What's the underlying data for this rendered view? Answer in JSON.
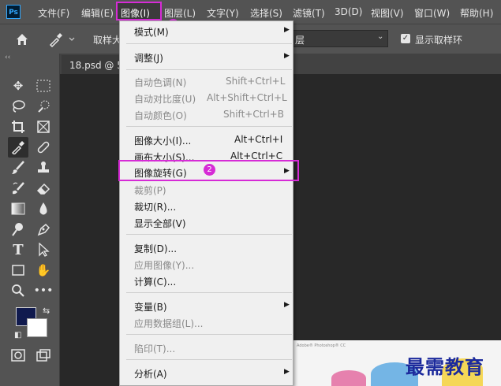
{
  "app": {
    "logo": "Ps"
  },
  "menubar": {
    "items": [
      "文件(F)",
      "编辑(E)",
      "图像(I)",
      "图层(L)",
      "文字(Y)",
      "选择(S)",
      "滤镜(T)",
      "3D(D)",
      "视图(V)",
      "窗口(W)",
      "帮助(H)"
    ],
    "active": "图像(I)"
  },
  "badges": {
    "first": "1",
    "second": "2"
  },
  "options_bar": {
    "sample_label": "取样大",
    "layer_value": "层",
    "ring_label": "显示取样环",
    "ring_checked": true
  },
  "toolbar": {
    "collapse": "‹‹"
  },
  "document": {
    "tab_label": "18.psd @ 5",
    "preview_text": "Adobe® Photoshop® CC"
  },
  "watermark": "最需教育",
  "image_menu": {
    "items": [
      {
        "label": "模式(M)",
        "submenu": true
      },
      {
        "label": "调整(J)",
        "submenu": true
      },
      {
        "label": "自动色调(N)",
        "shortcut": "Shift+Ctrl+L",
        "disabled": true
      },
      {
        "label": "自动对比度(U)",
        "shortcut": "Alt+Shift+Ctrl+L",
        "disabled": true
      },
      {
        "label": "自动颜色(O)",
        "shortcut": "Shift+Ctrl+B",
        "disabled": true
      },
      {
        "label": "图像大小(I)...",
        "shortcut": "Alt+Ctrl+I"
      },
      {
        "label": "画布大小(S)...",
        "shortcut": "Alt+Ctrl+C"
      },
      {
        "label": "图像旋转(G)",
        "submenu": true,
        "highlighted": true
      },
      {
        "label": "裁剪(P)",
        "disabled": true
      },
      {
        "label": "裁切(R)..."
      },
      {
        "label": "显示全部(V)"
      },
      {
        "label": "复制(D)..."
      },
      {
        "label": "应用图像(Y)...",
        "disabled": true
      },
      {
        "label": "计算(C)..."
      },
      {
        "label": "变量(B)",
        "submenu": true
      },
      {
        "label": "应用数据组(L)...",
        "disabled": true
      },
      {
        "label": "陷印(T)...",
        "disabled": true
      },
      {
        "label": "分析(A)",
        "submenu": true
      }
    ]
  },
  "colors": {
    "highlight": "#d62bd6",
    "foreground": "#101a4e",
    "background": "#ffffff"
  }
}
